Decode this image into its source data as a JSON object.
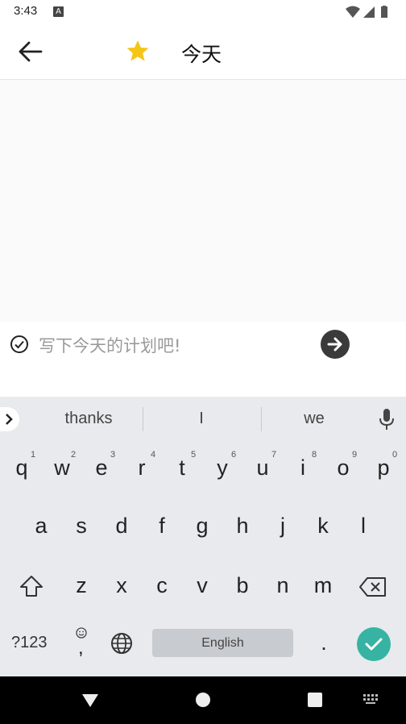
{
  "status_bar": {
    "time": "3:43",
    "notification_badge": "A"
  },
  "app_bar": {
    "title": "今天",
    "star_color": "#f5c518"
  },
  "input": {
    "placeholder": "写下今天的计划吧!"
  },
  "keyboard": {
    "suggestions": [
      "thanks",
      "I",
      "we"
    ],
    "row1": [
      "q",
      "w",
      "e",
      "r",
      "t",
      "y",
      "u",
      "i",
      "o",
      "p"
    ],
    "row1_hints": [
      "1",
      "2",
      "3",
      "4",
      "5",
      "6",
      "7",
      "8",
      "9",
      "0"
    ],
    "row2": [
      "a",
      "s",
      "d",
      "f",
      "g",
      "h",
      "j",
      "k",
      "l"
    ],
    "row3": [
      "z",
      "x",
      "c",
      "v",
      "b",
      "n",
      "m"
    ],
    "symbols_key": "?123",
    "emoji_comma_key": ",",
    "space_label": "English",
    "period_key": ".",
    "enter_color": "#37b3a3"
  }
}
